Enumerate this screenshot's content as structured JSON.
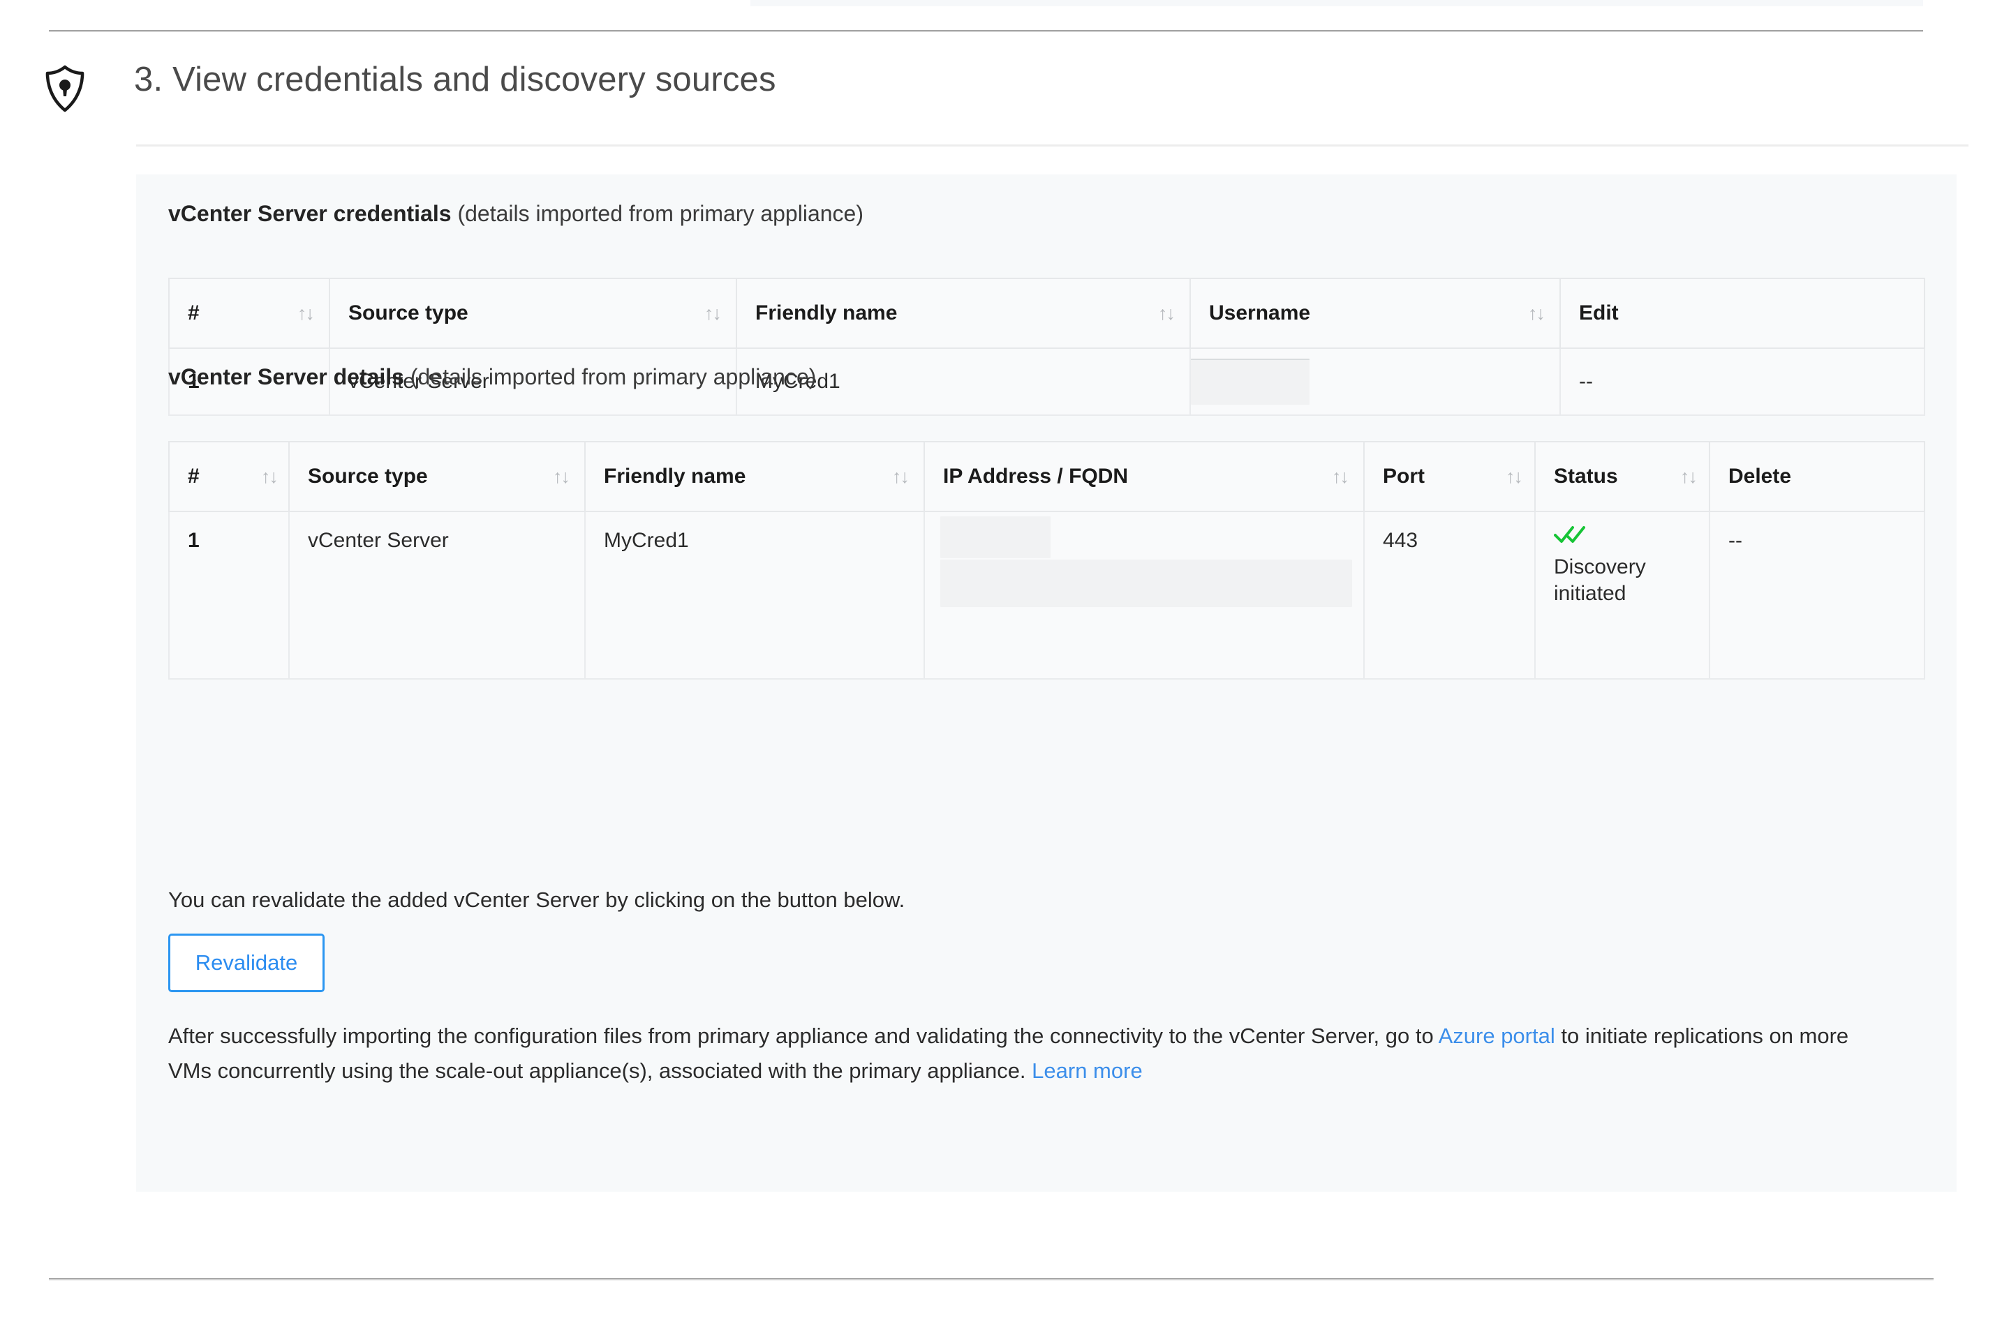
{
  "section": {
    "number_title": "3. View credentials and discovery sources",
    "icon": "shield-keyhole-icon"
  },
  "credentials_block": {
    "title_bold": "vCenter Server credentials",
    "title_sub": " (details imported from primary appliance)",
    "columns": [
      "#",
      "Source type",
      "Friendly name",
      "Username",
      "Edit"
    ],
    "sortable": [
      true,
      true,
      true,
      true,
      false
    ],
    "rows": [
      {
        "index": "1",
        "source_type": "vCenter Server",
        "friendly_name": "MyCred1",
        "username": "",
        "username_redacted": true,
        "edit": "--"
      }
    ]
  },
  "details_block": {
    "title_bold": "vCenter Server details",
    "title_sub": " (details imported from primary appliance)",
    "columns": [
      "#",
      "Source type",
      "Friendly name",
      "IP Address / FQDN",
      "Port",
      "Status",
      "Delete"
    ],
    "sortable": [
      true,
      true,
      true,
      true,
      true,
      true,
      false
    ],
    "rows": [
      {
        "index": "1",
        "source_type": "vCenter Server",
        "friendly_name": "MyCred1",
        "ip_address": "",
        "ip_redacted": true,
        "port": "443",
        "status_icon": "double-check-icon",
        "status_text": "Discovery initiated",
        "delete": "--"
      }
    ]
  },
  "revalidate": {
    "hint": "You can revalidate the added vCenter Server by clicking on the button below.",
    "button_label": "Revalidate"
  },
  "footnote": {
    "part1": "After successfully importing the configuration files from primary appliance and validating the connectivity to the vCenter Server, go to ",
    "link1": "Azure portal",
    "part2": " to initiate replications on more VMs concurrently using the scale-out appliance(s), associated with the primary appliance. ",
    "link2": "Learn more"
  },
  "colors": {
    "link": "#3b8eea",
    "button_border": "#2b96f1",
    "status_check": "#16c436",
    "card_bg": "#f7f9fa",
    "table_header_bg": "#f9fafb",
    "redaction": "#f1f2f3"
  },
  "sort_glyph": "↑↓"
}
